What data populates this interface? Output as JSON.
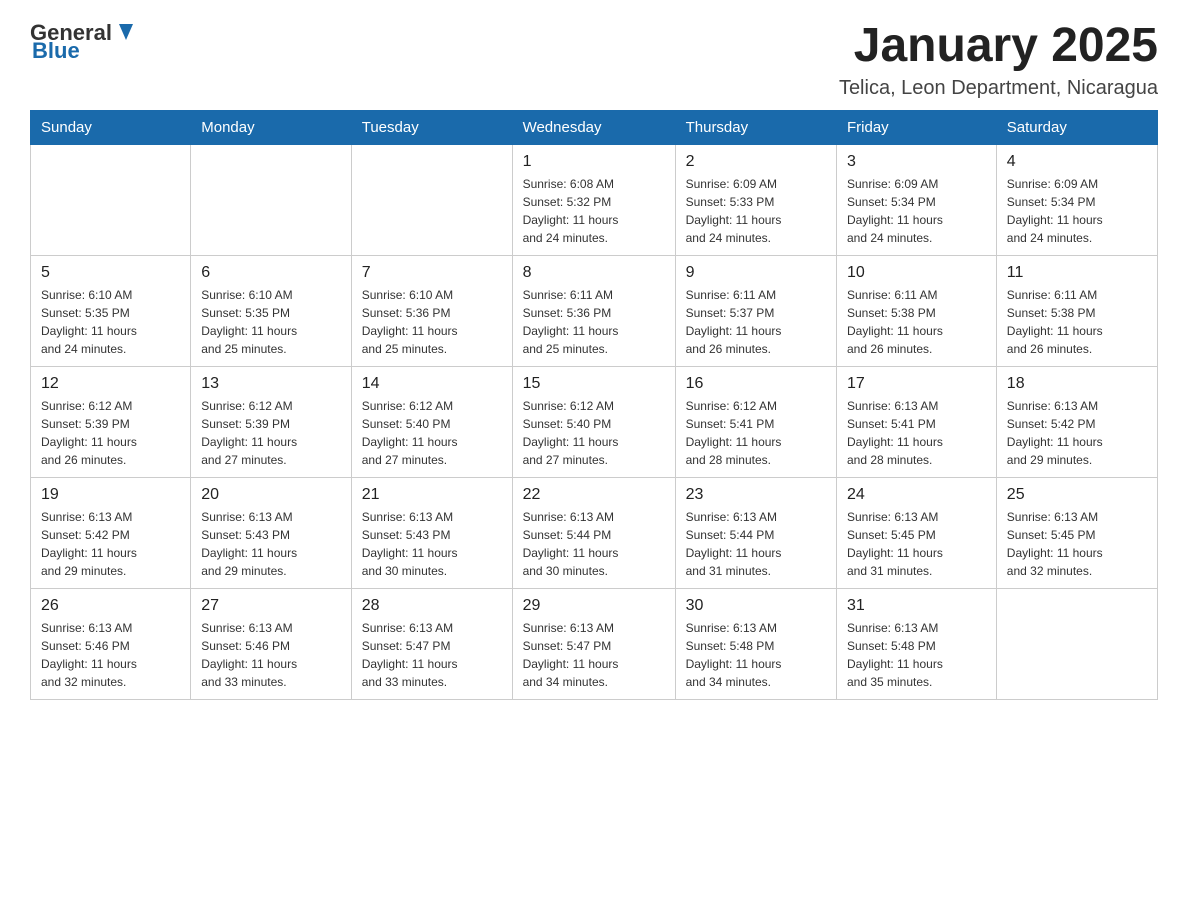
{
  "header": {
    "logo": {
      "general": "General",
      "blue": "Blue"
    },
    "title": "January 2025",
    "location": "Telica, Leon Department, Nicaragua"
  },
  "calendar": {
    "days_of_week": [
      "Sunday",
      "Monday",
      "Tuesday",
      "Wednesday",
      "Thursday",
      "Friday",
      "Saturday"
    ],
    "weeks": [
      [
        {
          "day": "",
          "info": ""
        },
        {
          "day": "",
          "info": ""
        },
        {
          "day": "",
          "info": ""
        },
        {
          "day": "1",
          "info": "Sunrise: 6:08 AM\nSunset: 5:32 PM\nDaylight: 11 hours\nand 24 minutes."
        },
        {
          "day": "2",
          "info": "Sunrise: 6:09 AM\nSunset: 5:33 PM\nDaylight: 11 hours\nand 24 minutes."
        },
        {
          "day": "3",
          "info": "Sunrise: 6:09 AM\nSunset: 5:34 PM\nDaylight: 11 hours\nand 24 minutes."
        },
        {
          "day": "4",
          "info": "Sunrise: 6:09 AM\nSunset: 5:34 PM\nDaylight: 11 hours\nand 24 minutes."
        }
      ],
      [
        {
          "day": "5",
          "info": "Sunrise: 6:10 AM\nSunset: 5:35 PM\nDaylight: 11 hours\nand 24 minutes."
        },
        {
          "day": "6",
          "info": "Sunrise: 6:10 AM\nSunset: 5:35 PM\nDaylight: 11 hours\nand 25 minutes."
        },
        {
          "day": "7",
          "info": "Sunrise: 6:10 AM\nSunset: 5:36 PM\nDaylight: 11 hours\nand 25 minutes."
        },
        {
          "day": "8",
          "info": "Sunrise: 6:11 AM\nSunset: 5:36 PM\nDaylight: 11 hours\nand 25 minutes."
        },
        {
          "day": "9",
          "info": "Sunrise: 6:11 AM\nSunset: 5:37 PM\nDaylight: 11 hours\nand 26 minutes."
        },
        {
          "day": "10",
          "info": "Sunrise: 6:11 AM\nSunset: 5:38 PM\nDaylight: 11 hours\nand 26 minutes."
        },
        {
          "day": "11",
          "info": "Sunrise: 6:11 AM\nSunset: 5:38 PM\nDaylight: 11 hours\nand 26 minutes."
        }
      ],
      [
        {
          "day": "12",
          "info": "Sunrise: 6:12 AM\nSunset: 5:39 PM\nDaylight: 11 hours\nand 26 minutes."
        },
        {
          "day": "13",
          "info": "Sunrise: 6:12 AM\nSunset: 5:39 PM\nDaylight: 11 hours\nand 27 minutes."
        },
        {
          "day": "14",
          "info": "Sunrise: 6:12 AM\nSunset: 5:40 PM\nDaylight: 11 hours\nand 27 minutes."
        },
        {
          "day": "15",
          "info": "Sunrise: 6:12 AM\nSunset: 5:40 PM\nDaylight: 11 hours\nand 27 minutes."
        },
        {
          "day": "16",
          "info": "Sunrise: 6:12 AM\nSunset: 5:41 PM\nDaylight: 11 hours\nand 28 minutes."
        },
        {
          "day": "17",
          "info": "Sunrise: 6:13 AM\nSunset: 5:41 PM\nDaylight: 11 hours\nand 28 minutes."
        },
        {
          "day": "18",
          "info": "Sunrise: 6:13 AM\nSunset: 5:42 PM\nDaylight: 11 hours\nand 29 minutes."
        }
      ],
      [
        {
          "day": "19",
          "info": "Sunrise: 6:13 AM\nSunset: 5:42 PM\nDaylight: 11 hours\nand 29 minutes."
        },
        {
          "day": "20",
          "info": "Sunrise: 6:13 AM\nSunset: 5:43 PM\nDaylight: 11 hours\nand 29 minutes."
        },
        {
          "day": "21",
          "info": "Sunrise: 6:13 AM\nSunset: 5:43 PM\nDaylight: 11 hours\nand 30 minutes."
        },
        {
          "day": "22",
          "info": "Sunrise: 6:13 AM\nSunset: 5:44 PM\nDaylight: 11 hours\nand 30 minutes."
        },
        {
          "day": "23",
          "info": "Sunrise: 6:13 AM\nSunset: 5:44 PM\nDaylight: 11 hours\nand 31 minutes."
        },
        {
          "day": "24",
          "info": "Sunrise: 6:13 AM\nSunset: 5:45 PM\nDaylight: 11 hours\nand 31 minutes."
        },
        {
          "day": "25",
          "info": "Sunrise: 6:13 AM\nSunset: 5:45 PM\nDaylight: 11 hours\nand 32 minutes."
        }
      ],
      [
        {
          "day": "26",
          "info": "Sunrise: 6:13 AM\nSunset: 5:46 PM\nDaylight: 11 hours\nand 32 minutes."
        },
        {
          "day": "27",
          "info": "Sunrise: 6:13 AM\nSunset: 5:46 PM\nDaylight: 11 hours\nand 33 minutes."
        },
        {
          "day": "28",
          "info": "Sunrise: 6:13 AM\nSunset: 5:47 PM\nDaylight: 11 hours\nand 33 minutes."
        },
        {
          "day": "29",
          "info": "Sunrise: 6:13 AM\nSunset: 5:47 PM\nDaylight: 11 hours\nand 34 minutes."
        },
        {
          "day": "30",
          "info": "Sunrise: 6:13 AM\nSunset: 5:48 PM\nDaylight: 11 hours\nand 34 minutes."
        },
        {
          "day": "31",
          "info": "Sunrise: 6:13 AM\nSunset: 5:48 PM\nDaylight: 11 hours\nand 35 minutes."
        },
        {
          "day": "",
          "info": ""
        }
      ]
    ]
  }
}
